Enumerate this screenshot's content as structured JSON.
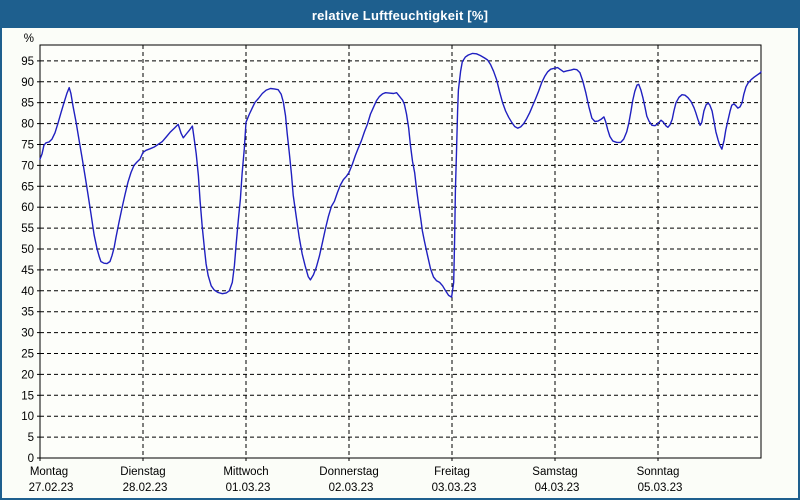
{
  "window_title": "relative Luftfeuchtigkeit [%]",
  "colors": {
    "frame_blue": "#1e5f8e",
    "line_blue": "#2020c0",
    "grid_black": "#000000",
    "background": "#fbfdf8",
    "text": "#000000"
  },
  "chart_data": {
    "type": "line",
    "title": "relative Luftfeuchtigkeit [%]",
    "ylabel": "%",
    "xlabel": "",
    "grid": "dashed",
    "legend": "none",
    "ylim": [
      0,
      98.8
    ],
    "yticks": [
      0,
      5,
      10,
      15,
      20,
      25,
      30,
      35,
      40,
      45,
      50,
      55,
      60,
      65,
      70,
      75,
      80,
      85,
      90,
      95
    ],
    "x_range_hours": [
      0,
      168
    ],
    "days": [
      {
        "label": "Montag",
        "date": "27.02.23"
      },
      {
        "label": "Dienstag",
        "date": "28.02.23"
      },
      {
        "label": "Mittwoch",
        "date": "01.03.23"
      },
      {
        "label": "Donnerstag",
        "date": "02.03.23"
      },
      {
        "label": "Freitag",
        "date": "03.03.23"
      },
      {
        "label": "Samstag",
        "date": "04.03.23"
      },
      {
        "label": "Sonntag",
        "date": "05.03.23"
      }
    ],
    "series": [
      {
        "name": "relative Luftfeuchtigkeit",
        "unit": "%",
        "color": "#2020c0",
        "points_t_hours_vs_percent": [
          [
            0,
            71.5
          ],
          [
            0.5,
            72.8
          ],
          [
            0.9,
            74.8
          ],
          [
            1.4,
            75.4
          ],
          [
            2.1,
            75.6
          ],
          [
            2.8,
            76.3
          ],
          [
            3.5,
            77.8
          ],
          [
            4.2,
            80.1
          ],
          [
            4.9,
            82.6
          ],
          [
            5.6,
            85.0
          ],
          [
            6.3,
            87.3
          ],
          [
            6.8,
            88.6
          ],
          [
            7.2,
            87.2
          ],
          [
            7.7,
            84.2
          ],
          [
            8.4,
            80.3
          ],
          [
            9.1,
            76.0
          ],
          [
            9.8,
            71.8
          ],
          [
            10.5,
            67.4
          ],
          [
            11.2,
            62.9
          ],
          [
            11.9,
            58.2
          ],
          [
            12.6,
            53.4
          ],
          [
            13.3,
            50.0
          ],
          [
            13.8,
            48.2
          ],
          [
            14.2,
            47.0
          ],
          [
            14.9,
            46.6
          ],
          [
            15.6,
            46.5
          ],
          [
            16.3,
            47.0
          ],
          [
            16.8,
            48.5
          ],
          [
            17.3,
            50.4
          ],
          [
            17.7,
            52.8
          ],
          [
            18.4,
            56.4
          ],
          [
            19.1,
            59.8
          ],
          [
            19.8,
            63.0
          ],
          [
            20.5,
            66.0
          ],
          [
            21.2,
            68.3
          ],
          [
            21.9,
            70.0
          ],
          [
            22.6,
            70.8
          ],
          [
            23.3,
            71.5
          ],
          [
            24,
            73.1
          ],
          [
            24.7,
            73.6
          ],
          [
            25.7,
            74.0
          ],
          [
            26.6,
            74.4
          ],
          [
            27.5,
            75.0
          ],
          [
            28.5,
            75.7
          ],
          [
            29.4,
            76.8
          ],
          [
            30.3,
            77.9
          ],
          [
            31.3,
            78.9
          ],
          [
            32.2,
            79.8
          ],
          [
            32.9,
            77.6
          ],
          [
            33.4,
            76.6
          ],
          [
            34.1,
            77.5
          ],
          [
            34.8,
            78.4
          ],
          [
            35.5,
            79.4
          ],
          [
            35.9,
            76.5
          ],
          [
            36.4,
            72.8
          ],
          [
            36.9,
            67.5
          ],
          [
            37.3,
            61.5
          ],
          [
            37.8,
            55.4
          ],
          [
            38.3,
            50.2
          ],
          [
            38.7,
            46.4
          ],
          [
            39.2,
            43.6
          ],
          [
            39.9,
            41.2
          ],
          [
            40.6,
            40.2
          ],
          [
            41.5,
            39.6
          ],
          [
            42.5,
            39.3
          ],
          [
            43.4,
            39.5
          ],
          [
            44.1,
            40.0
          ],
          [
            44.8,
            42.0
          ],
          [
            45.3,
            46.0
          ],
          [
            45.7,
            51.0
          ],
          [
            46.2,
            56.9
          ],
          [
            46.7,
            62.0
          ],
          [
            47.1,
            68.0
          ],
          [
            47.6,
            74.0
          ],
          [
            48,
            80.3
          ],
          [
            48.8,
            82.3
          ],
          [
            49.5,
            83.8
          ],
          [
            50.1,
            85.1
          ],
          [
            50.9,
            86.0
          ],
          [
            51.8,
            87.2
          ],
          [
            52.7,
            88.0
          ],
          [
            53.7,
            88.4
          ],
          [
            54.6,
            88.3
          ],
          [
            55.5,
            88.1
          ],
          [
            56.2,
            87.0
          ],
          [
            56.7,
            85.2
          ],
          [
            57.2,
            81.9
          ],
          [
            57.6,
            77.6
          ],
          [
            58.1,
            73.0
          ],
          [
            58.6,
            67.8
          ],
          [
            59,
            62.9
          ],
          [
            59.7,
            57.8
          ],
          [
            60.4,
            52.8
          ],
          [
            61.1,
            48.8
          ],
          [
            61.8,
            45.9
          ],
          [
            62.5,
            43.4
          ],
          [
            63,
            42.6
          ],
          [
            63.7,
            43.8
          ],
          [
            64.4,
            45.7
          ],
          [
            65.1,
            48.3
          ],
          [
            65.8,
            51.5
          ],
          [
            66.5,
            54.8
          ],
          [
            67.2,
            57.8
          ],
          [
            67.9,
            60.2
          ],
          [
            68.6,
            61.4
          ],
          [
            69.3,
            63.5
          ],
          [
            70,
            65.3
          ],
          [
            70.7,
            66.6
          ],
          [
            71.4,
            67.4
          ],
          [
            72,
            68.3
          ],
          [
            72.8,
            70.3
          ],
          [
            73.5,
            72.4
          ],
          [
            74.2,
            74.2
          ],
          [
            74.9,
            75.9
          ],
          [
            75.6,
            78.0
          ],
          [
            76.3,
            79.9
          ],
          [
            77,
            82.3
          ],
          [
            77.7,
            83.9
          ],
          [
            78.4,
            85.5
          ],
          [
            79.1,
            86.5
          ],
          [
            79.8,
            87.1
          ],
          [
            80.5,
            87.4
          ],
          [
            81.4,
            87.3
          ],
          [
            82.4,
            87.2
          ],
          [
            83.1,
            87.4
          ],
          [
            83.8,
            86.5
          ],
          [
            84.5,
            85.6
          ],
          [
            84.9,
            84.6
          ],
          [
            85.4,
            82.3
          ],
          [
            85.9,
            78.9
          ],
          [
            86.3,
            74.9
          ],
          [
            86.8,
            71.0
          ],
          [
            87.3,
            68.2
          ],
          [
            87.7,
            64.6
          ],
          [
            88.2,
            60.8
          ],
          [
            88.7,
            57.3
          ],
          [
            89.1,
            54.3
          ],
          [
            89.6,
            51.8
          ],
          [
            90.3,
            48.5
          ],
          [
            91,
            45.3
          ],
          [
            91.7,
            43.3
          ],
          [
            92.4,
            42.4
          ],
          [
            93.1,
            42.0
          ],
          [
            93.8,
            41.2
          ],
          [
            94.5,
            40.0
          ],
          [
            95.2,
            38.9
          ],
          [
            95.9,
            38.5
          ],
          [
            96.4,
            42.0
          ],
          [
            96.6,
            52.0
          ],
          [
            96.8,
            64.0
          ],
          [
            97.1,
            75.0
          ],
          [
            97.3,
            83.0
          ],
          [
            97.5,
            88.0
          ],
          [
            98,
            92.5
          ],
          [
            98.4,
            94.8
          ],
          [
            99.1,
            95.9
          ],
          [
            99.8,
            96.4
          ],
          [
            100.8,
            96.8
          ],
          [
            101.7,
            96.7
          ],
          [
            102.6,
            96.3
          ],
          [
            103.6,
            95.7
          ],
          [
            104.3,
            95.2
          ],
          [
            105,
            94.1
          ],
          [
            105.7,
            92.5
          ],
          [
            106.4,
            90.5
          ],
          [
            107.1,
            87.6
          ],
          [
            107.8,
            85.0
          ],
          [
            108.5,
            83.0
          ],
          [
            109.2,
            81.5
          ],
          [
            109.9,
            80.3
          ],
          [
            110.6,
            79.3
          ],
          [
            111.3,
            78.9
          ],
          [
            112,
            79.2
          ],
          [
            112.7,
            80.0
          ],
          [
            113.4,
            81.2
          ],
          [
            114.1,
            82.6
          ],
          [
            114.8,
            84.3
          ],
          [
            115.5,
            86.0
          ],
          [
            116.2,
            87.8
          ],
          [
            116.9,
            89.8
          ],
          [
            117.6,
            91.3
          ],
          [
            118.3,
            92.4
          ],
          [
            119,
            93.0
          ],
          [
            119.7,
            93.2
          ],
          [
            120.6,
            93.4
          ],
          [
            121.3,
            92.9
          ],
          [
            122,
            92.4
          ],
          [
            122.7,
            92.6
          ],
          [
            123.7,
            92.8
          ],
          [
            124.4,
            93.0
          ],
          [
            125.1,
            92.9
          ],
          [
            125.8,
            92.2
          ],
          [
            126.5,
            90.1
          ],
          [
            127.2,
            87.3
          ],
          [
            127.9,
            84.0
          ],
          [
            128.6,
            81.3
          ],
          [
            129.3,
            80.5
          ],
          [
            130,
            80.6
          ],
          [
            130.7,
            81.0
          ],
          [
            131.4,
            81.6
          ],
          [
            131.8,
            80.5
          ],
          [
            132.3,
            78.5
          ],
          [
            132.8,
            76.9
          ],
          [
            133.5,
            75.8
          ],
          [
            134.4,
            75.5
          ],
          [
            135.3,
            75.5
          ],
          [
            136,
            76.3
          ],
          [
            136.7,
            78.0
          ],
          [
            137.2,
            80.1
          ],
          [
            137.7,
            83.0
          ],
          [
            138.1,
            85.5
          ],
          [
            138.6,
            87.7
          ],
          [
            139.1,
            89.2
          ],
          [
            139.5,
            89.4
          ],
          [
            140,
            88.1
          ],
          [
            140.5,
            86.1
          ],
          [
            141,
            83.8
          ],
          [
            141.4,
            81.8
          ],
          [
            141.9,
            80.6
          ],
          [
            142.6,
            79.6
          ],
          [
            143.3,
            79.5
          ],
          [
            144,
            80.0
          ],
          [
            144.7,
            80.8
          ],
          [
            145.2,
            80.4
          ],
          [
            145.9,
            79.4
          ],
          [
            146.3,
            79.1
          ],
          [
            146.8,
            79.7
          ],
          [
            147.3,
            81.0
          ],
          [
            147.7,
            83.0
          ],
          [
            148.2,
            85.0
          ],
          [
            148.9,
            86.3
          ],
          [
            149.6,
            86.9
          ],
          [
            150.3,
            86.8
          ],
          [
            151,
            86.2
          ],
          [
            151.7,
            85.3
          ],
          [
            152.4,
            83.8
          ],
          [
            152.8,
            82.6
          ],
          [
            153.3,
            81.0
          ],
          [
            153.8,
            79.6
          ],
          [
            154.2,
            80.3
          ],
          [
            154.7,
            83.0
          ],
          [
            155.2,
            84.5
          ],
          [
            155.7,
            84.9
          ],
          [
            156.1,
            84.4
          ],
          [
            156.6,
            83.0
          ],
          [
            157,
            80.8
          ],
          [
            157.5,
            78.0
          ],
          [
            158,
            76.1
          ],
          [
            158.4,
            74.8
          ],
          [
            158.9,
            73.9
          ],
          [
            159.4,
            76.0
          ],
          [
            159.8,
            78.5
          ],
          [
            160.3,
            80.8
          ],
          [
            160.8,
            83.0
          ],
          [
            161.2,
            84.4
          ],
          [
            161.7,
            84.7
          ],
          [
            162.2,
            84.2
          ],
          [
            162.6,
            83.7
          ],
          [
            163.1,
            84.0
          ],
          [
            163.6,
            85.0
          ],
          [
            164,
            87.0
          ],
          [
            164.5,
            88.8
          ],
          [
            165,
            89.7
          ],
          [
            165.7,
            90.5
          ],
          [
            166.4,
            91.1
          ],
          [
            167.1,
            91.6
          ],
          [
            167.8,
            92.1
          ],
          [
            168,
            92.4
          ]
        ]
      }
    ]
  }
}
